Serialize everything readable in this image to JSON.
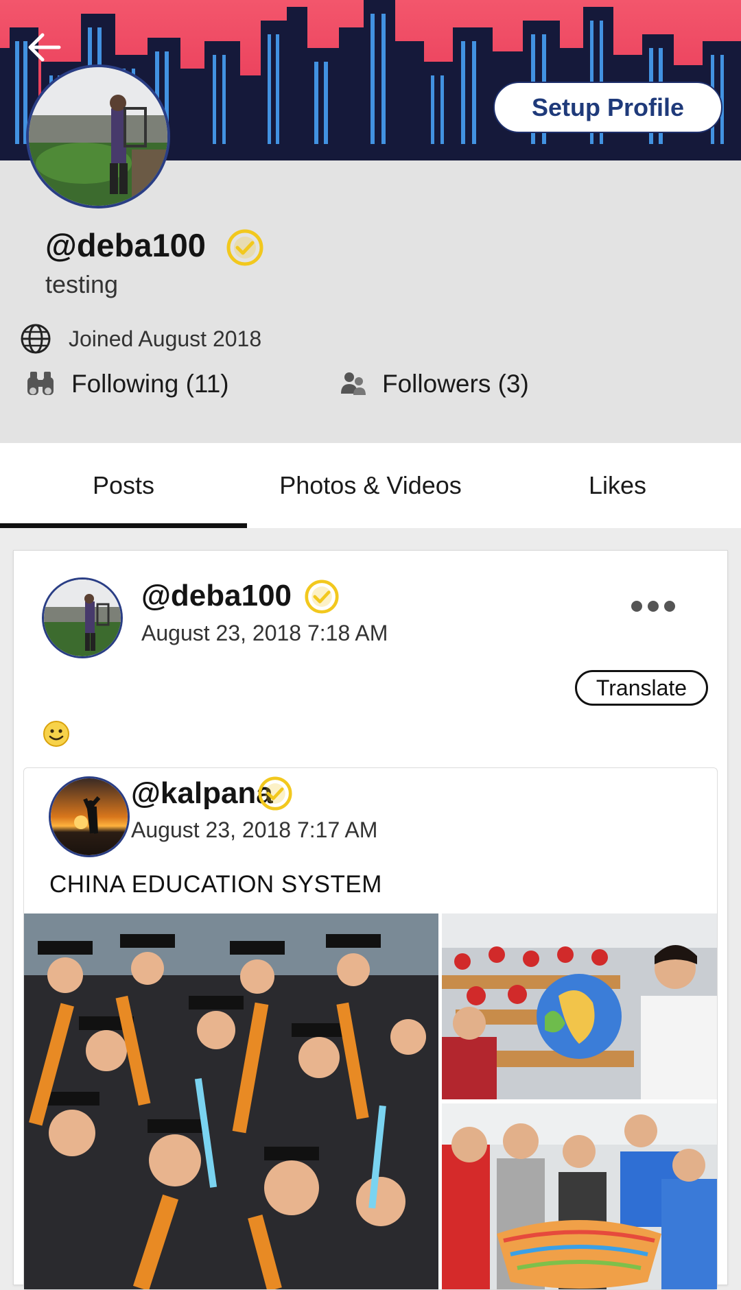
{
  "header": {
    "back_icon": "arrow-left-icon",
    "setup_label": "Setup Profile",
    "banner_colors": {
      "sky": "#ef4d66",
      "buildings": "#15193a",
      "windows": "#4aa8ff"
    }
  },
  "profile": {
    "handle": "@deba100",
    "bio": "testing",
    "joined": "Joined August 2018",
    "following": "Following (11)",
    "followers": "Followers (3)",
    "verified_color": "#f2c81e"
  },
  "tabs": [
    {
      "label": "Posts",
      "active": true
    },
    {
      "label": "Photos & Videos",
      "active": false
    },
    {
      "label": "Likes",
      "active": false
    }
  ],
  "post": {
    "handle": "@deba100",
    "date": "August 23, 2018 7:18 AM",
    "translate_label": "Translate",
    "emoji": "slightly-smiling-face",
    "shared": {
      "handle": "@kalpana",
      "date": "August 23, 2018 7:17 AM",
      "text": "CHINA EDUCATION SYSTEM",
      "photos": [
        "graduates-photo",
        "classroom-globe-photo",
        "students-basket-photo"
      ]
    }
  }
}
